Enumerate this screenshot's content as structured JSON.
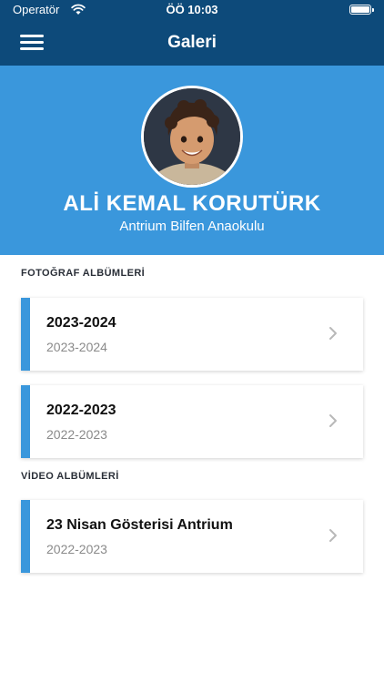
{
  "status_bar": {
    "carrier": "Operatör",
    "time": "ÖÖ 10:03"
  },
  "nav": {
    "title": "Galeri",
    "menu_icon": "hamburger-menu-icon"
  },
  "profile": {
    "name": "ALİ KEMAL KORUTÜRK",
    "school": "Antrium Bilfen Anaokulu"
  },
  "photo_section": {
    "title": "FOTOĞRAF ALBÜMLERİ",
    "albums": [
      {
        "title": "2023-2024",
        "subtitle": "2023-2024"
      },
      {
        "title": "2022-2023",
        "subtitle": "2022-2023"
      }
    ]
  },
  "video_section": {
    "title": "VİDEO ALBÜMLERİ",
    "albums": [
      {
        "title": "23 Nisan Gösterisi Antrium",
        "subtitle": "2022-2023"
      }
    ]
  },
  "colors": {
    "nav": "#0d4a7a",
    "accent": "#3a97dc"
  }
}
